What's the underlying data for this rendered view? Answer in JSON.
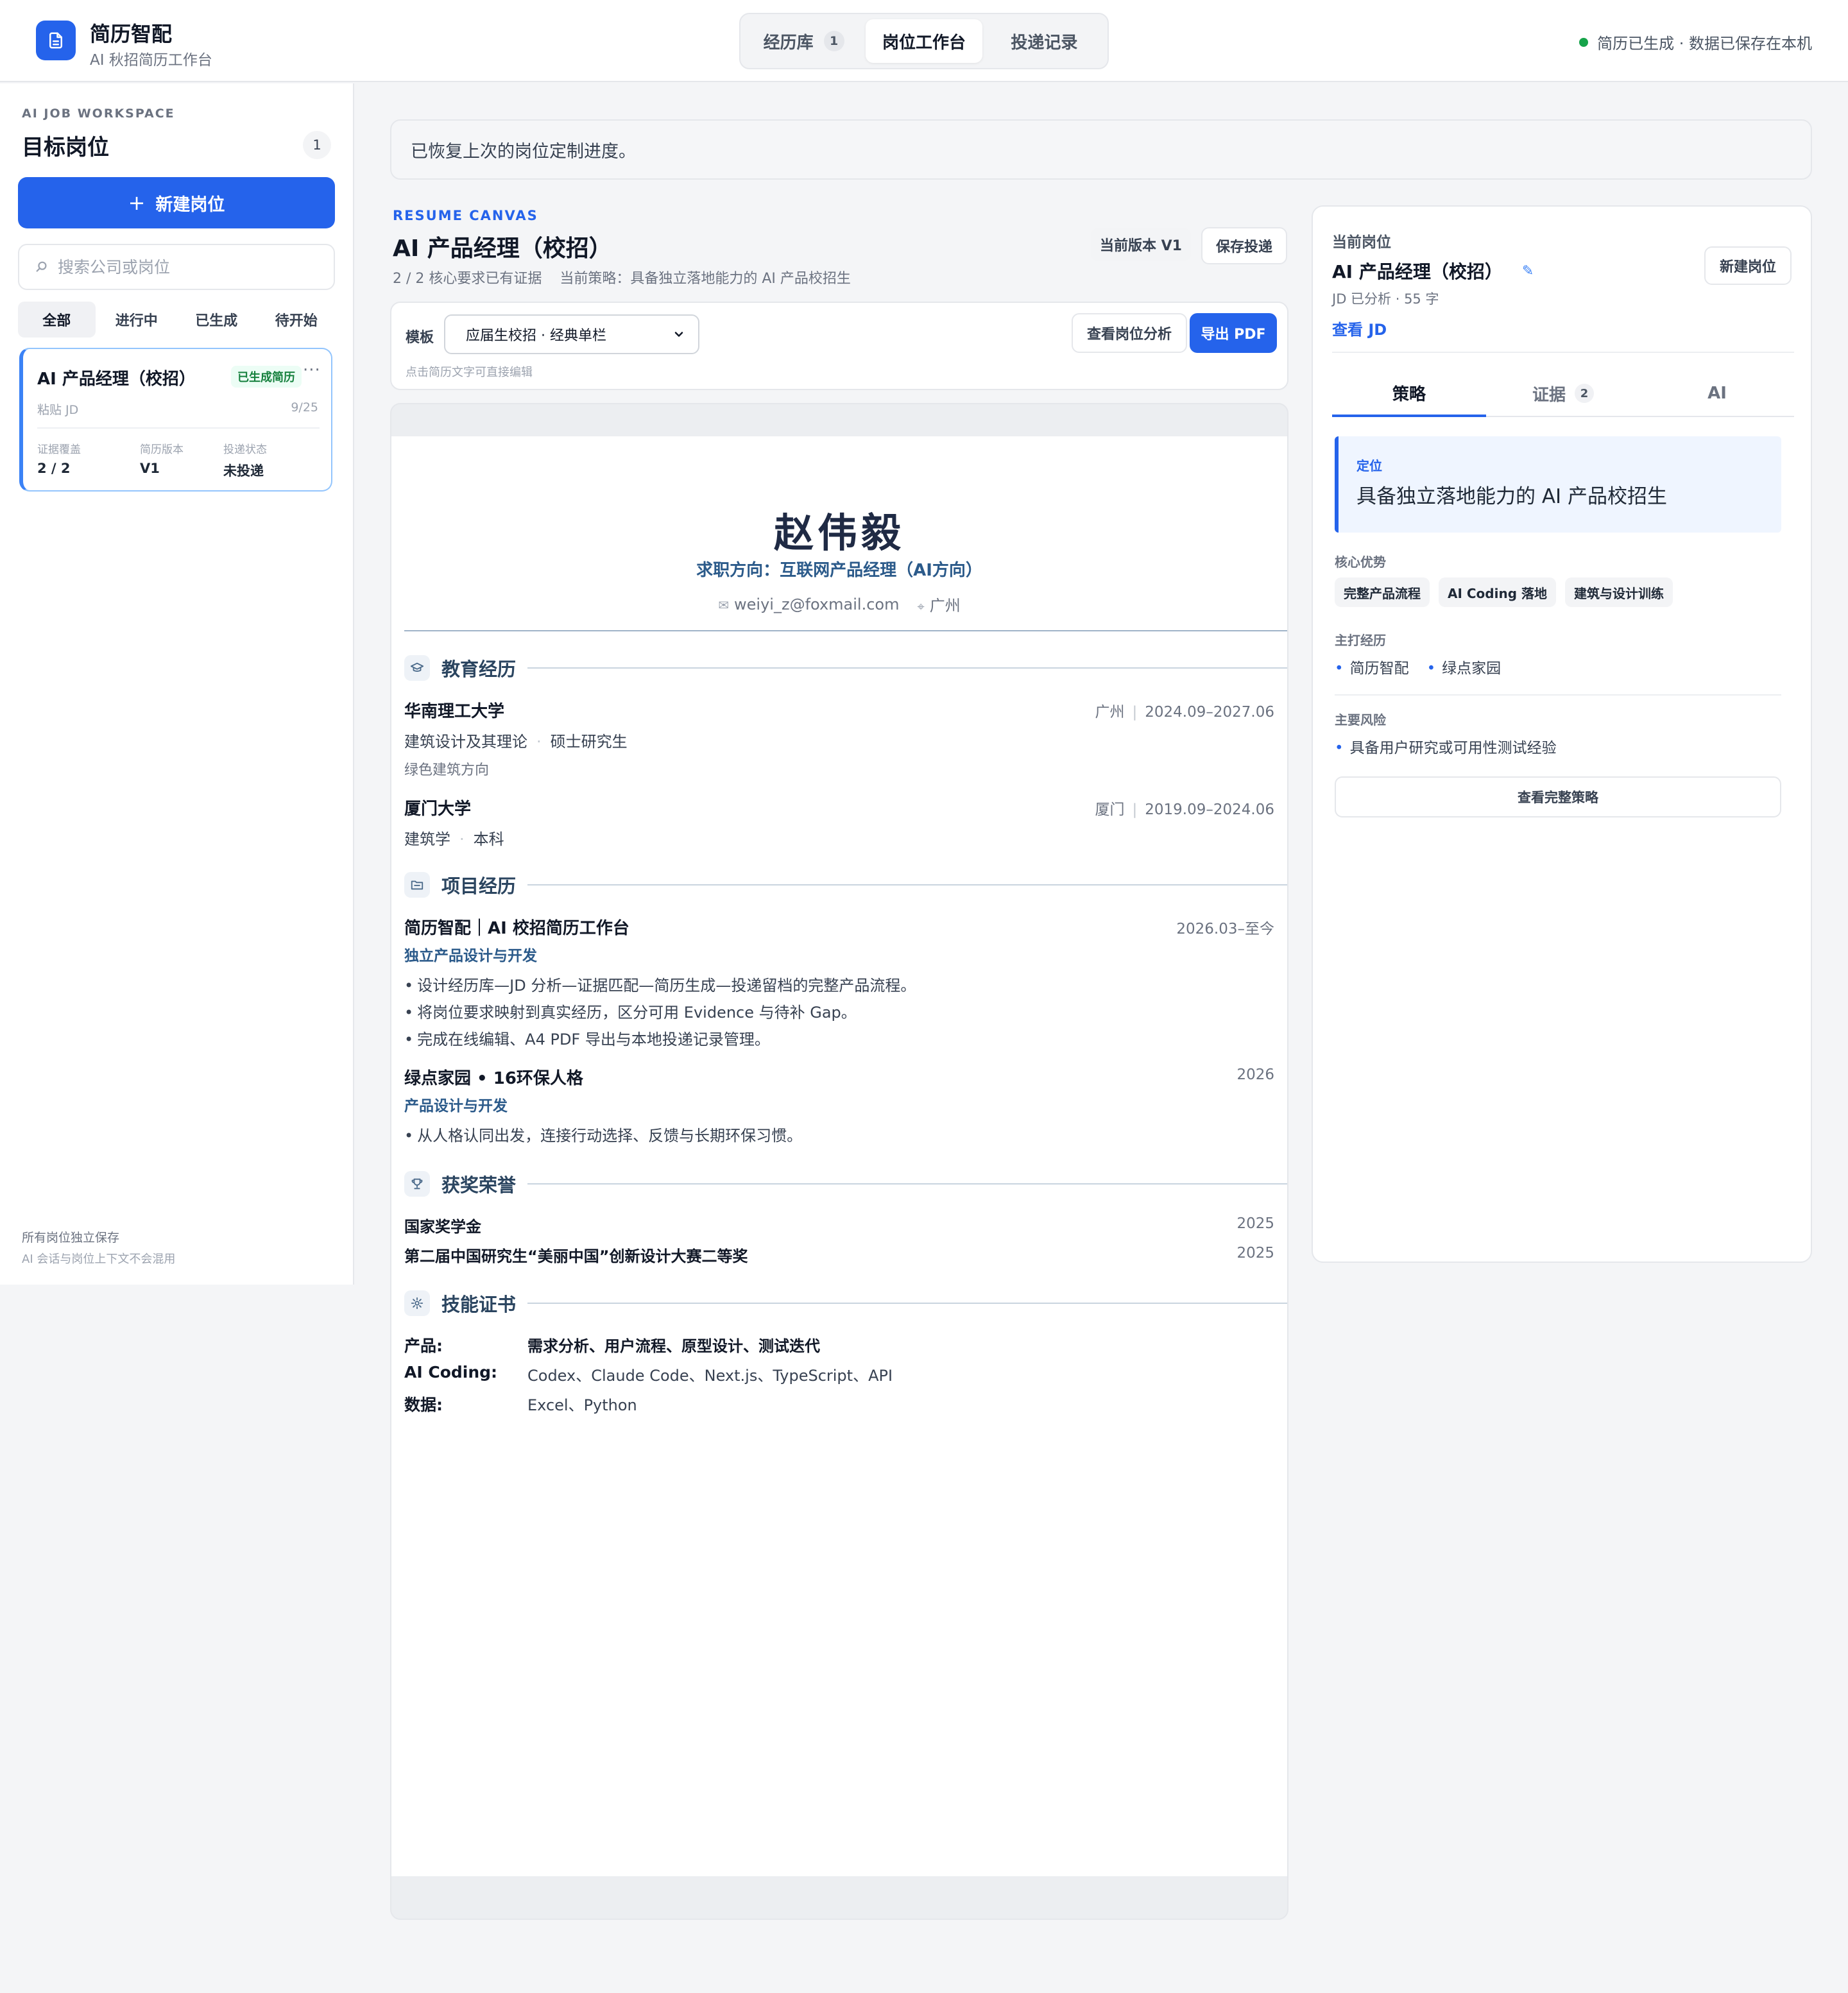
{
  "header": {
    "app_name": "简历智配",
    "app_sub": "AI 秋招简历工作台",
    "tabs": [
      {
        "label": "经历库",
        "badge": "1"
      },
      {
        "label": "岗位工作台",
        "badge": ""
      },
      {
        "label": "投递记录",
        "badge": ""
      }
    ],
    "status": "简历已生成 · 数据已保存在本机"
  },
  "sidebar": {
    "eyebrow": "AI JOB WORKSPACE",
    "title": "目标岗位",
    "count": "1",
    "new_button": "新建岗位",
    "search_placeholder": "搜索公司或岗位",
    "filters": [
      "全部",
      "进行中",
      "已生成",
      "待开始"
    ],
    "job": {
      "title": "AI 产品经理（校招）",
      "badge": "已生成简历",
      "more": "···",
      "source": "粘贴 JD",
      "date": "9/25",
      "stats": [
        {
          "label": "证据覆盖",
          "value": "2 / 2"
        },
        {
          "label": "简历版本",
          "value": "V1"
        },
        {
          "label": "投递状态",
          "value": "未投递"
        }
      ]
    },
    "footer_line1": "所有岗位独立保存",
    "footer_line2": "AI 会话与岗位上下文不会混用"
  },
  "notice": "已恢复上次的岗位定制进度。",
  "canvas": {
    "eyebrow": "RESUME CANVAS",
    "title": "AI 产品经理（校招）",
    "subtitle": "2 / 2 核心要求已有证据    当前策略：具备独立落地能力的 AI 产品校招生",
    "version": "当前版本 V1",
    "save_button": "保存投递",
    "template_label": "模板",
    "template_value": "应届生校招 · 经典单栏",
    "hint": "点击简历文字可直接编辑",
    "analyze_button": "查看岗位分析",
    "export_button": "导出 PDF"
  },
  "resume": {
    "name": "赵伟毅",
    "target": "求职方向：互联网产品经理（AI方向）",
    "email": "weiyi_z@foxmail.com",
    "city": "广州",
    "sections": {
      "education": "教育经历",
      "projects": "项目经历",
      "awards": "获奖荣誉",
      "skills": "技能证书"
    },
    "education": [
      {
        "school": "华南理工大学",
        "city": "广州",
        "period": "2024.09–2027.06",
        "major": "建筑设计及其理论",
        "degree": "硕士研究生",
        "note": "绿色建筑方向"
      },
      {
        "school": "厦门大学",
        "city": "厦门",
        "period": "2019.09–2024.06",
        "major": "建筑学",
        "degree": "本科"
      }
    ],
    "projects": [
      {
        "title": "简历智配｜AI 校招简历工作台",
        "period": "2026.03–至今",
        "role": "独立产品设计与开发",
        "bullets": [
          "设计经历库—JD 分析—证据匹配—简历生成—投递留档的完整产品流程。",
          "将岗位要求映射到真实经历，区分可用 Evidence 与待补 Gap。",
          "完成在线编辑、A4 PDF 导出与本地投递记录管理。"
        ]
      },
      {
        "title": "绿点家园 • 16环保人格",
        "period": "2026",
        "role": "产品设计与开发",
        "bullets": [
          "从人格认同出发，连接行动选择、反馈与长期环保习惯。"
        ]
      }
    ],
    "awards": [
      {
        "name": "国家奖学金",
        "year": "2025"
      },
      {
        "name": "第二届中国研究生“美丽中国”创新设计大赛二等奖",
        "year": "2025"
      }
    ],
    "skills": [
      {
        "key": "产品:",
        "value": "需求分析、用户流程、原型设计、测试迭代"
      },
      {
        "key": "AI Coding:",
        "value": "Codex、Claude Code、Next.js、TypeScript、API"
      },
      {
        "key": "数据:",
        "value": "Excel、Python"
      }
    ]
  },
  "panel": {
    "eyebrow": "当前岗位",
    "title": "AI 产品经理（校招）",
    "meta": "JD 已分析 · 55 字",
    "link": "查看 JD",
    "new_button": "新建岗位",
    "tabs": [
      {
        "label": "策略",
        "count": ""
      },
      {
        "label": "证据",
        "count": "2"
      },
      {
        "label": "AI",
        "count": ""
      }
    ],
    "position_label": "定位",
    "position_value": "具备独立落地能力的 AI 产品校招生",
    "strengths_label": "核心优势",
    "strengths": [
      "完整产品流程",
      "AI Coding 落地",
      "建筑与设计训练"
    ],
    "main_exp_label": "主打经历",
    "main_exp": [
      "简历智配",
      "绿点家园"
    ],
    "risk_label": "主要风险",
    "risks": [
      "具备用户研究或可用性测试经验"
    ],
    "full_button": "查看完整策略"
  },
  "colors": {
    "accent": "#2563eb",
    "success": "#16a34a",
    "resume_heading": "#2b4560"
  }
}
